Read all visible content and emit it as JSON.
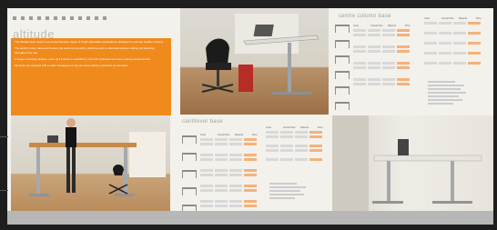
{
  "brochure": {
    "brand": "altitude",
    "section_centre": "centre column base",
    "section_cantilever": "cantilever base",
    "body_text": [
      "The Altitude desk system is a comprehensive range of height adjustable workstations designed to promote healthy working.",
      "The electric motor raises and lowers the desk top smoothly, allowing users to alternate between sitting and standing throughout the day.",
      "A range of worktop shapes, sizes and finishes is available to suit both individual and team working environments.",
      "All desks are supplied with a cable management tray and anti-collision protection as standard."
    ],
    "table_headers": [
      "Code",
      "Overall Size",
      "Material",
      "Price"
    ],
    "footer_left": "",
    "footer_right": ""
  },
  "colors": {
    "accent": "#f08a1c",
    "background": "#f3f1ec",
    "frame": "#1e1e1e",
    "footer": "#b7b7b7"
  }
}
